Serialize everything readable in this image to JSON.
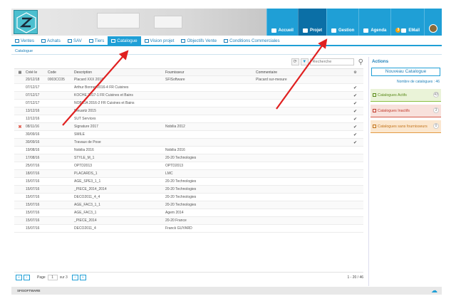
{
  "header": {
    "nav": [
      {
        "label": "Accueil",
        "icon": "home-icon"
      },
      {
        "label": "Projet",
        "icon": "document-icon",
        "active": true
      },
      {
        "label": "Gestion",
        "icon": "briefcase-icon"
      },
      {
        "label": "Agenda",
        "icon": "calendar-icon"
      },
      {
        "label": "EMail",
        "icon": "email-icon",
        "badge": "3"
      }
    ]
  },
  "subnav": [
    {
      "label": "Ventes",
      "icon": "cart-icon"
    },
    {
      "label": "Achats",
      "icon": "truck-icon"
    },
    {
      "label": "SAV",
      "icon": "wrench-icon"
    },
    {
      "label": "Tiers",
      "icon": "people-icon"
    },
    {
      "label": "Catalogue",
      "icon": "catalog-icon",
      "active": true
    },
    {
      "label": "Vision projet",
      "icon": "eye-icon"
    },
    {
      "label": "Objectifs Vente",
      "icon": "chart-icon"
    },
    {
      "label": "Conditions Commerciales",
      "icon": "handshake-icon"
    }
  ],
  "breadcrumb": "Catalogue",
  "search": {
    "placeholder": "Recherche"
  },
  "grid": {
    "columns": [
      "",
      "Créé le",
      "Code",
      "Description",
      "Fournisseur",
      "Commentaire",
      ""
    ],
    "rows": [
      [
        "",
        "20/12/18",
        "0003CC05",
        "Placard XXX 2018",
        "SFISoftware",
        "Placard sur-mesure",
        ""
      ],
      [
        "",
        "07/12/17",
        "",
        "Arthur Bonnet 2016-4 FR Cuisines",
        "",
        "",
        "✔"
      ],
      [
        "",
        "07/12/17",
        "",
        "KOCHE 2017-1 FR Cuisines et Bains",
        "",
        "",
        "✔"
      ],
      [
        "",
        "07/12/17",
        "",
        "NOBILIA 2016-2 FR Cuisines et Bains",
        "",
        "",
        "✔"
      ],
      [
        "",
        "13/12/16",
        "",
        "Bleuartz 2015",
        "",
        "",
        "✔"
      ],
      [
        "",
        "12/12/16",
        "",
        "SUT Services",
        "",
        "",
        "✔"
      ],
      [
        "✖",
        "08/11/16",
        "",
        "Signature 2017",
        "Nobilia 2012",
        "",
        "✔"
      ],
      [
        "",
        "30/09/16",
        "",
        "SMILE",
        "",
        "",
        "✔"
      ],
      [
        "",
        "30/09/16",
        "",
        "Travaux de Pose",
        "",
        "",
        "✔"
      ],
      [
        "",
        "19/08/16",
        "",
        "Nobilia 2016",
        "Nobilia 2016",
        "",
        ""
      ],
      [
        "",
        "17/08/16",
        "",
        "STYLE_M_1",
        "20-20 Technologies",
        "",
        ""
      ],
      [
        "",
        "25/07/16",
        "",
        "OPTD2013",
        "OPTD2013",
        "",
        ""
      ],
      [
        "",
        "18/07/16",
        "",
        "PLACARDS_1",
        "LMC",
        "",
        ""
      ],
      [
        "",
        "15/07/16",
        "",
        "AGE_SPE3_1_1",
        "20-20 Technologies",
        "",
        ""
      ],
      [
        "",
        "15/07/16",
        "",
        "_PIECE_2014_2014",
        "20-20 Technologies",
        "",
        ""
      ],
      [
        "",
        "15/07/16",
        "",
        "DECO2011_4_4",
        "20-20 Technologies",
        "",
        ""
      ],
      [
        "",
        "15/07/16",
        "",
        "AGE_FAC3_1_1",
        "20-20 Technologies",
        "",
        ""
      ],
      [
        "",
        "15/07/16",
        "",
        "AGE_FAC3_1",
        "Agem 2014",
        "",
        ""
      ],
      [
        "",
        "15/07/16",
        "",
        "_PIECE_2014",
        "20-20 France",
        "",
        ""
      ],
      [
        "",
        "15/07/16",
        "",
        "DECO2011_4",
        "Franck GUYARD",
        "",
        ""
      ]
    ]
  },
  "pager": {
    "page_label": "Page",
    "page": "1",
    "of_label": "sur 3",
    "count": "1 - 20 / 46"
  },
  "side": {
    "title": "Actions",
    "new_button": "Nouveau Catalogue",
    "count_label": "Nombre de catalogues : 46",
    "panels": [
      {
        "label": "Catalogues Actifs",
        "count": "43"
      },
      {
        "label": "Catalogues Inactifs",
        "count": "3"
      },
      {
        "label": "Catalogues sans fournisseurs",
        "count": "0"
      }
    ]
  },
  "footer": {
    "logo": "SFISOFTWARE"
  },
  "colors": {
    "accent": "#1f9fd6",
    "active_nav": "#0b6fa6",
    "arrow": "#e02020"
  }
}
